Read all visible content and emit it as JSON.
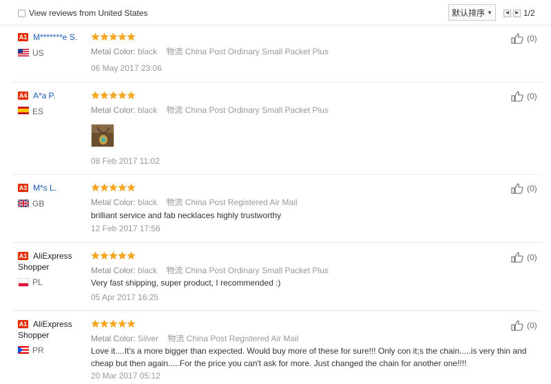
{
  "filter": {
    "label": "View reviews from United States"
  },
  "sort": {
    "label": "默认排序"
  },
  "pager": {
    "indicator": "1/2"
  },
  "reviews": [
    {
      "level": "A1",
      "name": "M*******e S.",
      "country": "US",
      "meta_label": "Metal Color:",
      "meta_value": "black",
      "ship_label": "物流",
      "shipping": "China Post Ordinary Small Packet Plus",
      "text": "",
      "date": "06 May 2017 23:06",
      "helpful": "(0)",
      "stars": 5
    },
    {
      "level": "A4",
      "name": "A*a P.",
      "country": "ES",
      "meta_label": "Metal Color:",
      "meta_value": "black",
      "ship_label": "物流",
      "shipping": "China Post Ordinary Small Packet Plus",
      "text": "",
      "date": "08 Feb 2017 11:02",
      "helpful": "(0)",
      "stars": 5,
      "has_photo": true
    },
    {
      "level": "A3",
      "name": "M*s L.",
      "country": "GB",
      "meta_label": "Metal Color:",
      "meta_value": "black",
      "ship_label": "物流",
      "shipping": "China Post Registered Air Mail",
      "text": "brilliant service and fab necklaces highly trustworthy",
      "date": "12 Feb 2017 17:56",
      "helpful": "(0)",
      "stars": 5
    },
    {
      "level": "A1",
      "name": "AliExpress Shopper",
      "country": "PL",
      "meta_label": "Metal Color:",
      "meta_value": "black",
      "ship_label": "物流",
      "shipping": "China Post Ordinary Small Packet Plus",
      "text": "Very fast shipping, super product, I recommended :)",
      "date": "05 Apr 2017 16:25",
      "helpful": "(0)",
      "stars": 5
    },
    {
      "level": "A1",
      "name": "AliExpress Shopper",
      "country": "PR",
      "meta_label": "Metal Color:",
      "meta_value": "Silver",
      "ship_label": "物流",
      "shipping": "China Post Registered Air Mail",
      "text": "Love it....It's a more bigger than expected. Would buy more of these for sure!!! Only con it;s the chain.....is very thin and cheap but then again.....For the price you can't ask for more. Just changed the chain for another one!!!!",
      "date": "20 Mar 2017 05:12",
      "helpful": "(0)",
      "stars": 5
    }
  ],
  "icons": {
    "star": "star-icon",
    "thumb": "thumbs-up-icon",
    "chevron": "chevron-down-icon",
    "prev": "chevron-left-icon",
    "next": "chevron-right-icon"
  },
  "colors": {
    "star": "#f5a623",
    "badge": "#e62e04",
    "link": "#1a5ab4"
  }
}
